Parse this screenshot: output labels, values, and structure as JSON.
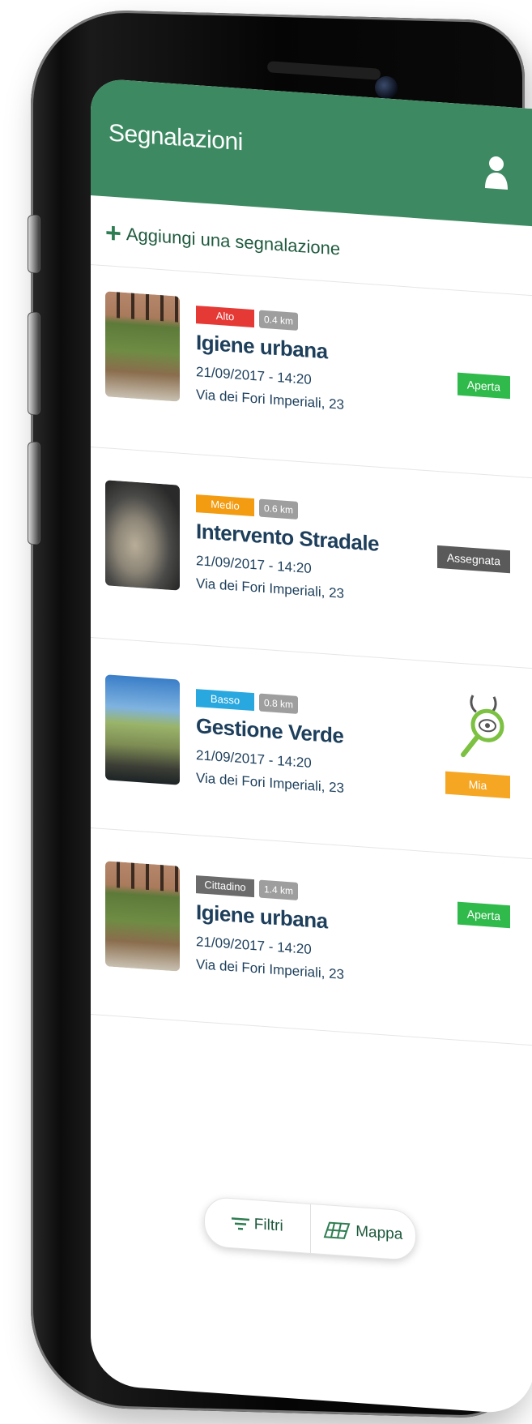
{
  "appbar": {
    "title": "Segnalazioni",
    "user_icon": "user-icon",
    "color": "#3d8a62"
  },
  "add": {
    "icon": "plus-icon",
    "label": "Aggiungi una segnalazione"
  },
  "reports": [
    {
      "priority": "Alto",
      "priority_color": "#e53935",
      "distance": "0.4 km",
      "title": "Igiene urbana",
      "datetime": "21/09/2017 - 14:20",
      "address": "Via dei Fori Imperiali, 23",
      "status": "Aperta",
      "status_color": "#2fba4b",
      "photo": "ruins-with-litter"
    },
    {
      "priority": "Medio",
      "priority_color": "#f39c12",
      "distance": "0.6 km",
      "title": "Intervento Stradale",
      "datetime": "21/09/2017 - 14:20",
      "address": "Via dei Fori Imperiali, 23",
      "status": "Assegnata",
      "status_color": "#5a5a5a",
      "photo": "pothole"
    },
    {
      "priority": "Basso",
      "priority_color": "#29a8e0",
      "distance": "0.8 km",
      "title": "Gestione Verde",
      "datetime": "21/09/2017 - 14:20",
      "address": "Via dei Fori Imperiali, 23",
      "status": "Mia",
      "status_color": "#f5a623",
      "status_icon": "magnifier-eye-icon",
      "photo": "fallen-tree"
    },
    {
      "priority": "Cittadino",
      "priority_color": "#6b6b6b",
      "distance": "1.4 km",
      "title": "Igiene urbana",
      "datetime": "21/09/2017 - 14:20",
      "address": "Via dei Fori Imperiali, 23",
      "status": "Aperta",
      "status_color": "#2fba4b",
      "photo": "ruins-with-litter"
    }
  ],
  "bottom_bar": {
    "filters_label": "Filtri",
    "filters_icon": "filter-icon",
    "map_label": "Mappa",
    "map_icon": "map-icon"
  }
}
